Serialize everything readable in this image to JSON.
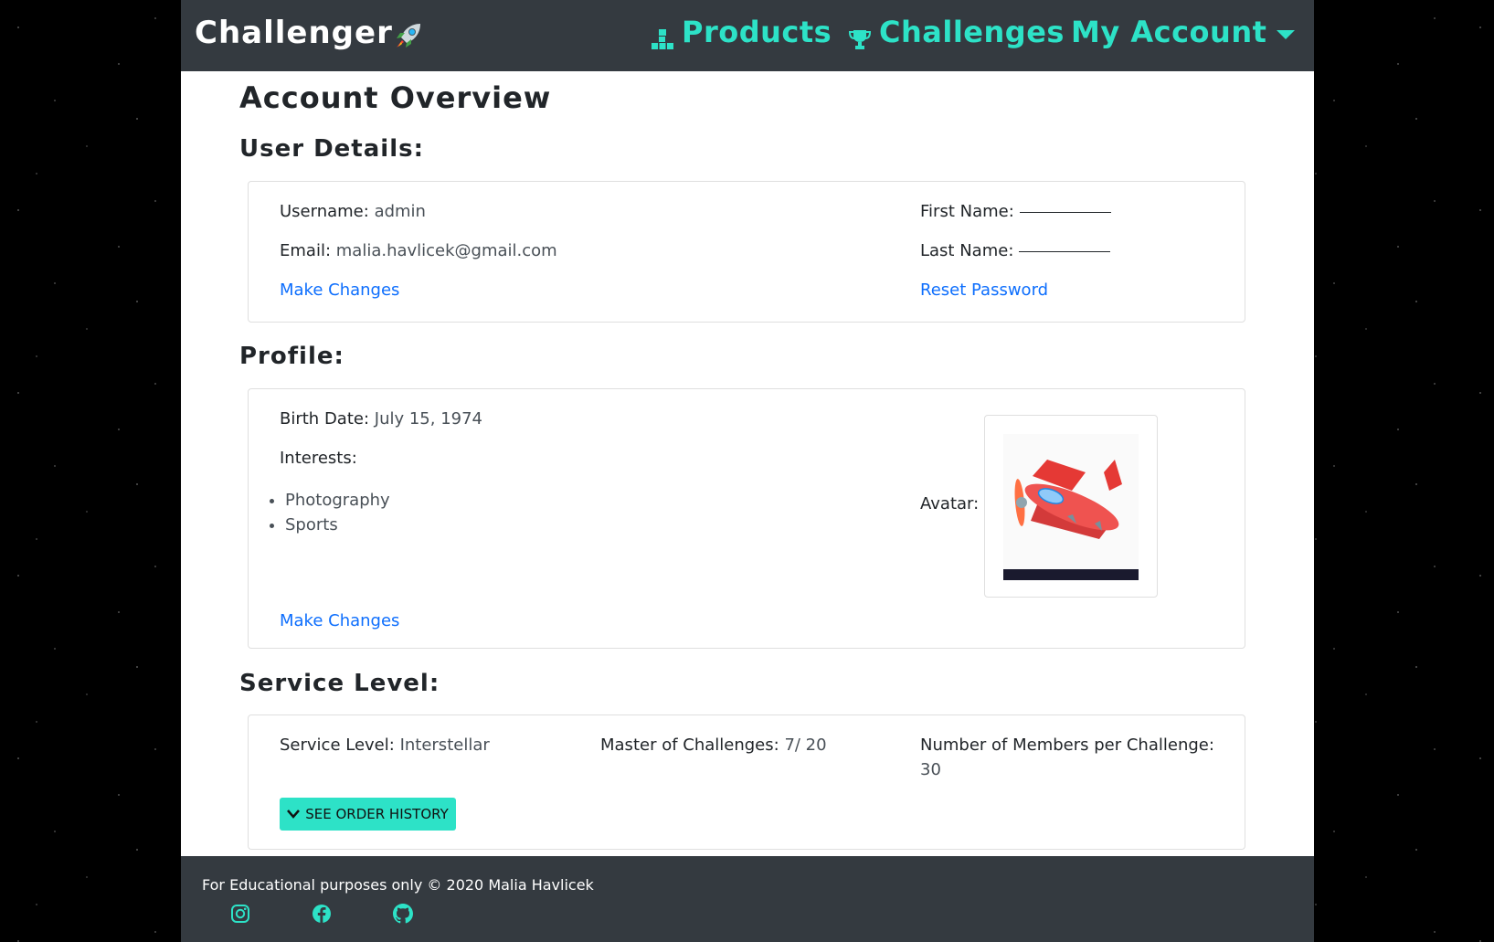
{
  "nav": {
    "brand": "Challenger",
    "brand_icon": "rocket-icon",
    "products": "Products",
    "challenges": "Challenges",
    "account": "My Account",
    "accent": "#2de2c7"
  },
  "page": {
    "title": "Account Overview"
  },
  "user_details": {
    "heading": "User Details:",
    "username_label": "Username:",
    "username": "admin",
    "email_label": "Email:",
    "email": "malia.havlicek@gmail.com",
    "first_name_label": "First Name:",
    "last_name_label": "Last Name:",
    "make_changes": "Make Changes",
    "reset_password": "Reset Password"
  },
  "profile": {
    "heading": "Profile:",
    "birth_label": "Birth Date:",
    "birth_date": "July 15, 1974",
    "interests_label": "Interests:",
    "interests": [
      "Photography",
      "Sports"
    ],
    "avatar_label": "Avatar:",
    "make_changes": "Make Changes"
  },
  "service": {
    "heading": "Service Level:",
    "level_label": "Service Level:",
    "level": "Interstellar",
    "master_label": "Master of Challenges:",
    "master_value": "7/ 20",
    "members_label": "Number of Members per Challenge:",
    "members_value": "30",
    "order_button": "SEE ORDER HISTORY"
  },
  "footer": {
    "text": "For Educational purposes only © 2020 Malia Havlicek",
    "icons": [
      "instagram-icon",
      "facebook-icon",
      "github-icon"
    ]
  }
}
